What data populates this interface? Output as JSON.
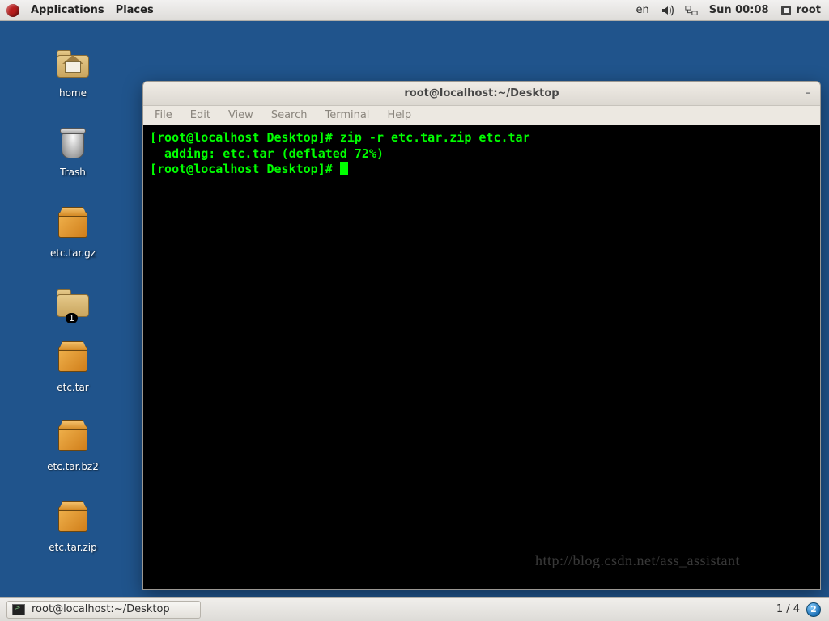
{
  "top_panel": {
    "applications": "Applications",
    "places": "Places",
    "lang": "en",
    "clock": "Sun 00:08",
    "user": "root"
  },
  "desktop_icons": {
    "home": "home",
    "trash": "Trash",
    "etc_tar_gz": "etc.tar.gz",
    "folder1_badge": "1",
    "etc_tar": "etc.tar",
    "etc_tar_bz2": "etc.tar.bz2",
    "etc_tar_zip": "etc.tar.zip"
  },
  "terminal": {
    "title": "root@localhost:~/Desktop",
    "menu": {
      "file": "File",
      "edit": "Edit",
      "view": "View",
      "search": "Search",
      "terminal": "Terminal",
      "help": "Help"
    },
    "line1": "[root@localhost Desktop]# zip -r etc.tar.zip etc.tar",
    "line2": "  adding: etc.tar (deflated 72%)",
    "line3": "[root@localhost Desktop]# "
  },
  "taskbar": {
    "task_label": "root@localhost:~/Desktop",
    "workspace": "1 / 4",
    "ws_current": "2"
  },
  "watermark": "http://blog.csdn.net/ass_assistant"
}
